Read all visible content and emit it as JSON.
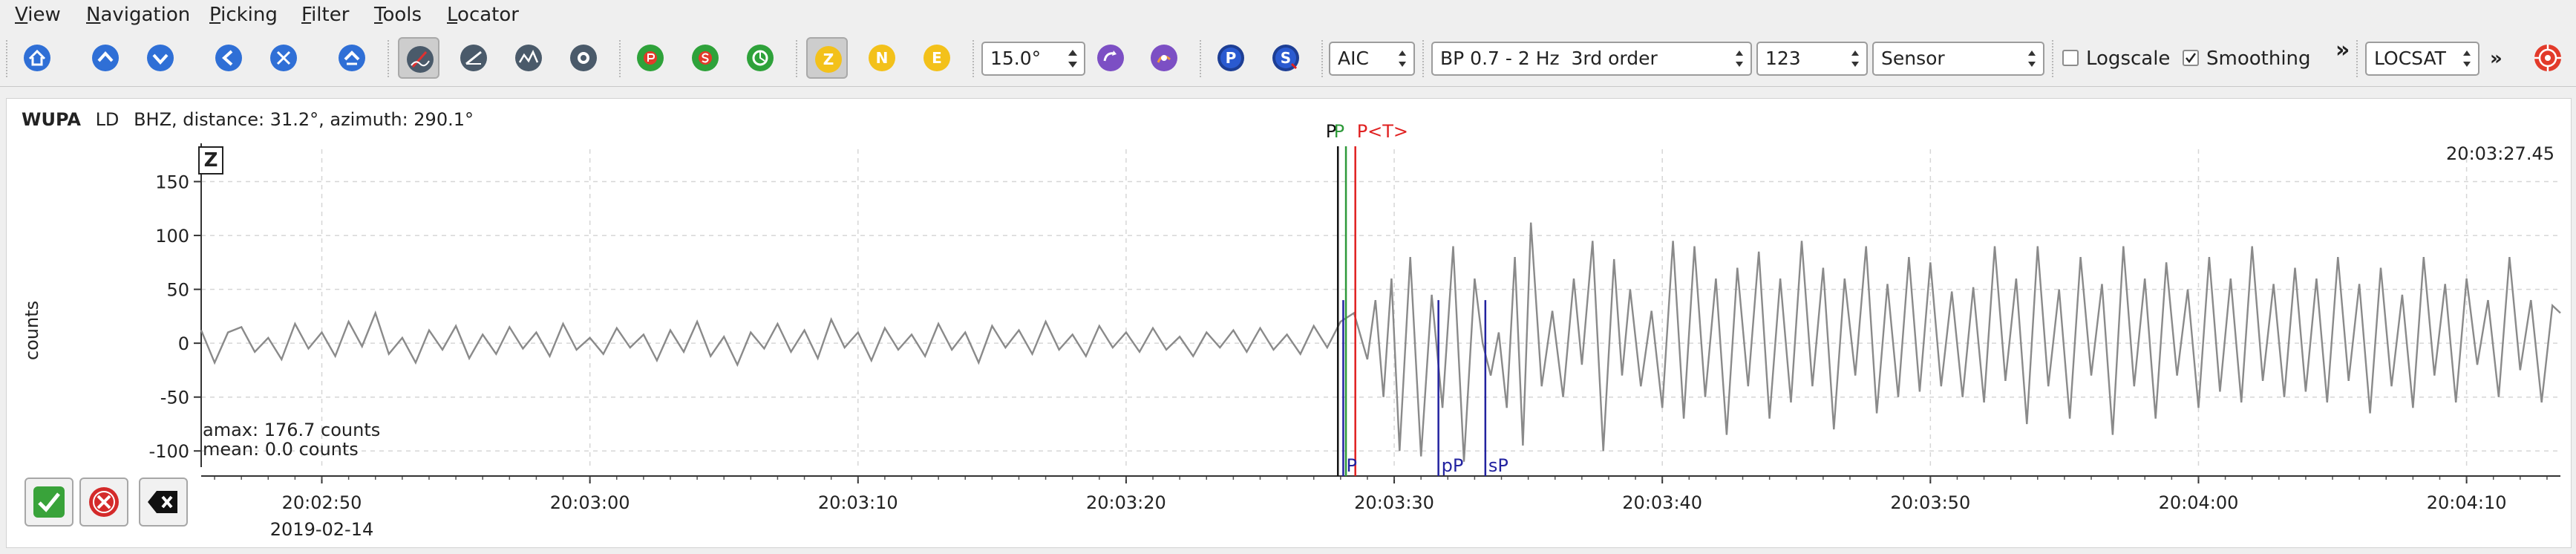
{
  "menu": [
    "View",
    "Navigation",
    "Picking",
    "Filter",
    "Tools",
    "Locator"
  ],
  "toolbar": {
    "icons": [
      "home-icon",
      "scroll-up-icon",
      "scroll-down-icon",
      "step-left-icon",
      "step-right-icon",
      "step-previous-icon",
      "pick-mode-icon",
      "align-icon",
      "zoom-trace-icon",
      "record-icon",
      "apply-p-icon",
      "apply-s-icon",
      "apply-all-icon"
    ],
    "component_z": "Z",
    "component_n": "N",
    "component_e": "E",
    "rotation": "15.0°",
    "phase_p": "P",
    "phase_s": "S",
    "picker": "AIC",
    "filter": "BP 0.7 - 2 Hz  3rd order",
    "counts_mode": "123",
    "unit": "Sensor",
    "logscale_label": "Logscale",
    "logscale_checked": false,
    "smoothing_label": "Smoothing",
    "smoothing_checked": true,
    "more": "»",
    "locator": "LOCSAT",
    "more2": "»"
  },
  "trace": {
    "station": "WUPA",
    "location": "LD",
    "channel": "BHZ",
    "info": ", distance: 31.2°, azimuth: 290.1°",
    "component_badge": "Z",
    "current_time": "20:03:27.45",
    "ylabel": "counts",
    "amax": "amax: 176.7 counts",
    "mean": "mean: 0.0 counts",
    "date": "2019-02-14"
  },
  "chart_data": {
    "type": "line",
    "xlabel": "",
    "ylabel": "counts",
    "ylim": [
      -115,
      180
    ],
    "xlim_seconds": [
      45.5,
      133.5
    ],
    "xticks": [
      {
        "t": 50,
        "label": "20:02:50"
      },
      {
        "t": 60,
        "label": "20:03:00"
      },
      {
        "t": 70,
        "label": "20:03:10"
      },
      {
        "t": 80,
        "label": "20:03:20"
      },
      {
        "t": 90,
        "label": "20:03:30"
      },
      {
        "t": 100,
        "label": "20:03:40"
      },
      {
        "t": 110,
        "label": "20:03:50"
      },
      {
        "t": 120,
        "label": "20:04:00"
      },
      {
        "t": 130,
        "label": "20:04:10"
      }
    ],
    "yticks": [
      150,
      100,
      50,
      0,
      -50,
      -100
    ],
    "grid": true,
    "series": [
      {
        "values": [
          [
            45.5,
            12
          ],
          [
            46.0,
            -18
          ],
          [
            46.5,
            10
          ],
          [
            47.0,
            15
          ],
          [
            47.5,
            -8
          ],
          [
            48.0,
            5
          ],
          [
            48.5,
            -15
          ],
          [
            49.0,
            18
          ],
          [
            49.5,
            -5
          ],
          [
            50.0,
            10
          ],
          [
            50.5,
            -12
          ],
          [
            51.0,
            20
          ],
          [
            51.5,
            -3
          ],
          [
            52.0,
            28
          ],
          [
            52.5,
            -10
          ],
          [
            53.0,
            5
          ],
          [
            53.5,
            -18
          ],
          [
            54.0,
            12
          ],
          [
            54.5,
            -6
          ],
          [
            55.0,
            16
          ],
          [
            55.5,
            -14
          ],
          [
            56.0,
            8
          ],
          [
            56.5,
            -10
          ],
          [
            57.0,
            15
          ],
          [
            57.5,
            -5
          ],
          [
            58.0,
            10
          ],
          [
            58.5,
            -12
          ],
          [
            59.0,
            18
          ],
          [
            59.5,
            -6
          ],
          [
            60.0,
            5
          ],
          [
            60.5,
            -10
          ],
          [
            61.0,
            14
          ],
          [
            61.5,
            -4
          ],
          [
            62.0,
            8
          ],
          [
            62.5,
            -16
          ],
          [
            63.0,
            12
          ],
          [
            63.5,
            -8
          ],
          [
            64.0,
            20
          ],
          [
            64.5,
            -12
          ],
          [
            65.0,
            6
          ],
          [
            65.5,
            -20
          ],
          [
            66.0,
            10
          ],
          [
            66.5,
            -5
          ],
          [
            67.0,
            18
          ],
          [
            67.5,
            -8
          ],
          [
            68.0,
            12
          ],
          [
            68.5,
            -14
          ],
          [
            69.0,
            22
          ],
          [
            69.5,
            -4
          ],
          [
            70.0,
            10
          ],
          [
            70.5,
            -16
          ],
          [
            71.0,
            14
          ],
          [
            71.5,
            -6
          ],
          [
            72.0,
            8
          ],
          [
            72.5,
            -12
          ],
          [
            73.0,
            18
          ],
          [
            73.5,
            -6
          ],
          [
            74.0,
            10
          ],
          [
            74.5,
            -18
          ],
          [
            75.0,
            16
          ],
          [
            75.5,
            -4
          ],
          [
            76.0,
            12
          ],
          [
            76.5,
            -10
          ],
          [
            77.0,
            20
          ],
          [
            77.5,
            -6
          ],
          [
            78.0,
            8
          ],
          [
            78.5,
            -12
          ],
          [
            79.0,
            16
          ],
          [
            79.5,
            -4
          ],
          [
            80.0,
            10
          ],
          [
            80.5,
            -8
          ],
          [
            81.0,
            14
          ],
          [
            81.5,
            -6
          ],
          [
            82.0,
            6
          ],
          [
            82.5,
            -12
          ],
          [
            83.0,
            10
          ],
          [
            83.5,
            -4
          ],
          [
            84.0,
            12
          ],
          [
            84.5,
            -8
          ],
          [
            85.0,
            14
          ],
          [
            85.5,
            -6
          ],
          [
            86.0,
            8
          ],
          [
            86.5,
            -10
          ],
          [
            87.0,
            16
          ],
          [
            87.5,
            -4
          ],
          [
            88.0,
            20
          ],
          [
            88.5,
            28
          ],
          [
            89.0,
            -15
          ],
          [
            89.3,
            40
          ],
          [
            89.6,
            -50
          ],
          [
            89.9,
            60
          ],
          [
            90.2,
            -100
          ],
          [
            90.6,
            80
          ],
          [
            91.0,
            -105
          ],
          [
            91.4,
            45
          ],
          [
            91.8,
            -60
          ],
          [
            92.2,
            90
          ],
          [
            92.6,
            -110
          ],
          [
            93.0,
            60
          ],
          [
            93.3,
            0
          ],
          [
            93.6,
            -30
          ],
          [
            93.9,
            10
          ],
          [
            94.2,
            -60
          ],
          [
            94.5,
            80
          ],
          [
            94.8,
            -95
          ],
          [
            95.1,
            112
          ],
          [
            95.5,
            -40
          ],
          [
            95.9,
            30
          ],
          [
            96.3,
            -50
          ],
          [
            96.7,
            60
          ],
          [
            97.0,
            -20
          ],
          [
            97.4,
            95
          ],
          [
            97.8,
            -100
          ],
          [
            98.2,
            78
          ],
          [
            98.5,
            -30
          ],
          [
            98.8,
            50
          ],
          [
            99.2,
            -40
          ],
          [
            99.6,
            30
          ],
          [
            100.0,
            -60
          ],
          [
            100.4,
            95
          ],
          [
            100.8,
            -70
          ],
          [
            101.2,
            90
          ],
          [
            101.6,
            -50
          ],
          [
            102.0,
            60
          ],
          [
            102.4,
            -85
          ],
          [
            102.8,
            70
          ],
          [
            103.2,
            -40
          ],
          [
            103.6,
            85
          ],
          [
            104.0,
            -70
          ],
          [
            104.4,
            60
          ],
          [
            104.8,
            -55
          ],
          [
            105.2,
            95
          ],
          [
            105.6,
            -40
          ],
          [
            106.0,
            70
          ],
          [
            106.4,
            -80
          ],
          [
            106.8,
            60
          ],
          [
            107.2,
            -30
          ],
          [
            107.6,
            90
          ],
          [
            108.0,
            -65
          ],
          [
            108.4,
            55
          ],
          [
            108.8,
            -50
          ],
          [
            109.2,
            80
          ],
          [
            109.6,
            -45
          ],
          [
            110.0,
            75
          ],
          [
            110.4,
            -40
          ],
          [
            110.8,
            48
          ],
          [
            111.2,
            -50
          ],
          [
            111.6,
            52
          ],
          [
            112.0,
            -55
          ],
          [
            112.4,
            90
          ],
          [
            112.8,
            -35
          ],
          [
            113.2,
            60
          ],
          [
            113.6,
            -75
          ],
          [
            114.0,
            90
          ],
          [
            114.4,
            -40
          ],
          [
            114.8,
            50
          ],
          [
            115.2,
            -70
          ],
          [
            115.6,
            80
          ],
          [
            116.0,
            -30
          ],
          [
            116.4,
            55
          ],
          [
            116.8,
            -85
          ],
          [
            117.2,
            90
          ],
          [
            117.6,
            -40
          ],
          [
            118.0,
            60
          ],
          [
            118.4,
            -70
          ],
          [
            118.8,
            75
          ],
          [
            119.2,
            -30
          ],
          [
            119.6,
            50
          ],
          [
            120.0,
            -60
          ],
          [
            120.4,
            80
          ],
          [
            120.8,
            -45
          ],
          [
            121.2,
            60
          ],
          [
            121.6,
            -55
          ],
          [
            122.0,
            90
          ],
          [
            122.4,
            -35
          ],
          [
            122.8,
            55
          ],
          [
            123.2,
            -50
          ],
          [
            123.6,
            70
          ],
          [
            124.0,
            -45
          ],
          [
            124.4,
            60
          ],
          [
            124.8,
            -55
          ],
          [
            125.2,
            80
          ],
          [
            125.6,
            -35
          ],
          [
            126.0,
            55
          ],
          [
            126.4,
            -65
          ],
          [
            126.8,
            70
          ],
          [
            127.2,
            -40
          ],
          [
            127.6,
            45
          ],
          [
            128.0,
            -60
          ],
          [
            128.4,
            80
          ],
          [
            128.8,
            -30
          ],
          [
            129.2,
            55
          ],
          [
            129.6,
            -55
          ],
          [
            130.0,
            60
          ],
          [
            130.4,
            -20
          ],
          [
            130.8,
            40
          ],
          [
            131.2,
            -50
          ],
          [
            131.6,
            80
          ],
          [
            132.0,
            -25
          ],
          [
            132.4,
            40
          ],
          [
            132.8,
            -55
          ],
          [
            133.2,
            35
          ],
          [
            133.5,
            28
          ]
        ]
      }
    ],
    "picks": [
      {
        "t": 87.9,
        "label": "P",
        "color": "#111111",
        "pos": "top"
      },
      {
        "t": 88.2,
        "label": "P",
        "color": "#2e9a3a",
        "pos": "top"
      },
      {
        "t": 88.55,
        "label": "P<T>",
        "color": "#e02020",
        "pos": "top"
      },
      {
        "t": 88.1,
        "label": "P",
        "color": "#2323a0",
        "pos": "bottom"
      },
      {
        "t": 91.65,
        "label": "pP",
        "color": "#2323a0",
        "pos": "bottom"
      },
      {
        "t": 93.4,
        "label": "sP",
        "color": "#2323a0",
        "pos": "bottom"
      }
    ]
  },
  "colors": {
    "trace": "#8a8a8a",
    "grid": "#d6d6d6",
    "blue_icon": "#2f6fd6",
    "green_icon": "#2ea23a",
    "yellow_icon": "#f3c11a",
    "purple_icon": "#7c4fc4",
    "red_icon": "#e23a2a"
  }
}
